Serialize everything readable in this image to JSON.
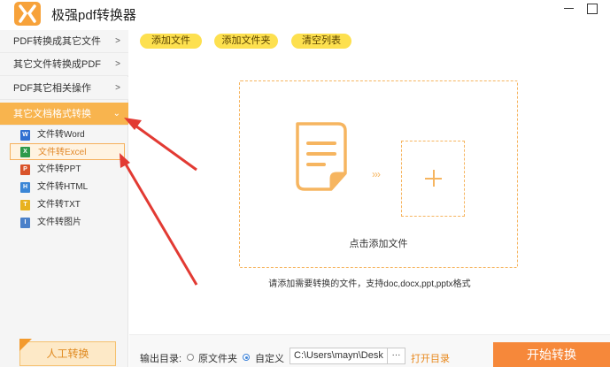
{
  "app": {
    "title": "极强pdf转换器",
    "accent_color": "#f8b44e",
    "logo_icon": "x-logo-icon"
  },
  "sidebar": {
    "categories": [
      {
        "label": "PDF转换成其它文件",
        "arrow": ">"
      },
      {
        "label": "其它文件转换成PDF",
        "arrow": ">"
      },
      {
        "label": "PDF其它相关操作",
        "arrow": ">"
      },
      {
        "label": "其它文档格式转换",
        "arrow": "⌄",
        "active": true
      }
    ],
    "sub_items": [
      {
        "label": "文件转Word",
        "icon": "word-file-icon",
        "badge": "W"
      },
      {
        "label": "文件转Excel",
        "icon": "excel-file-icon",
        "badge": "X",
        "selected": true
      },
      {
        "label": "文件转PPT",
        "icon": "ppt-file-icon",
        "badge": "P"
      },
      {
        "label": "文件转HTML",
        "icon": "html-file-icon",
        "badge": "H"
      },
      {
        "label": "文件转TXT",
        "icon": "txt-file-icon",
        "badge": "T"
      },
      {
        "label": "文件转图片",
        "icon": "image-file-icon",
        "badge": "I"
      }
    ],
    "manual_button": "人工转换"
  },
  "toolbar": {
    "add_file": "添加文件",
    "add_folder": "添加文件夹",
    "clear_list": "清空列表"
  },
  "dropzone": {
    "label": "点击添加文件",
    "arrows": "›››",
    "hint": "请添加需要转换的文件，支持doc,docx,ppt,pptx格式"
  },
  "output": {
    "label": "输出目录:",
    "option_original": "原文件夹",
    "option_custom": "自定义",
    "selected": "自定义",
    "path": "C:\\Users\\mayn\\Desk",
    "browse": "···",
    "open_dir": "打开目录"
  },
  "start_button": "开始转换"
}
